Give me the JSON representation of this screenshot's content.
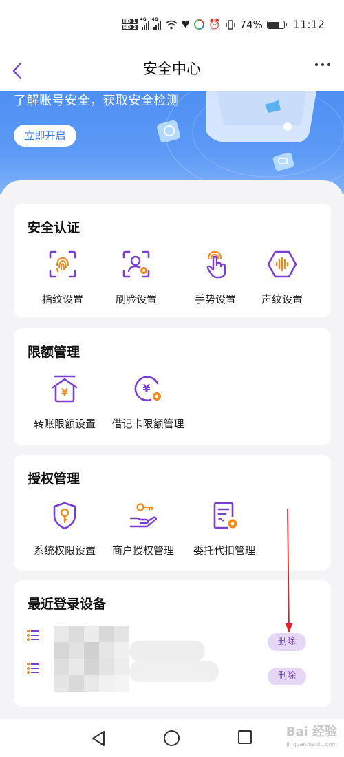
{
  "status_bar": {
    "battery": "74%",
    "time": "11:12",
    "hd1": "HD 1",
    "hd2": "HD 2",
    "net1": "4G",
    "net2": "4G"
  },
  "header": {
    "title": "安全中心"
  },
  "banner": {
    "text": "了解账号安全，获取安全检测",
    "button": "立即开启"
  },
  "sections": {
    "auth": {
      "title": "安全认证",
      "items": [
        {
          "label": "指纹设置",
          "icon": "fingerprint-icon"
        },
        {
          "label": "刷脸设置",
          "icon": "face-scan-icon"
        },
        {
          "label": "手势设置",
          "icon": "gesture-icon"
        },
        {
          "label": "声纹设置",
          "icon": "voiceprint-icon"
        }
      ]
    },
    "limit": {
      "title": "限额管理",
      "items": [
        {
          "label": "转账限额设置",
          "icon": "transfer-limit-icon"
        },
        {
          "label": "借记卡限额管理",
          "icon": "debit-card-limit-icon"
        }
      ]
    },
    "permission": {
      "title": "授权管理",
      "items": [
        {
          "label": "系统权限设置",
          "icon": "shield-key-icon"
        },
        {
          "label": "商户授权管理",
          "icon": "merchant-key-icon"
        },
        {
          "label": "委托代扣管理",
          "icon": "entrust-doc-icon"
        }
      ]
    },
    "devices": {
      "title": "最近登录设备",
      "rows": [
        {
          "delete_label": "删除"
        },
        {
          "delete_label": "删除"
        }
      ]
    }
  },
  "watermark": {
    "text": "Bai 经验",
    "sub": "jingyan.baidu.com"
  },
  "colors": {
    "accent_purple": "#7a3fd1",
    "accent_orange": "#f28a1c",
    "banner_blue": "#5d9af6",
    "delete_bg": "#e4d8f6"
  }
}
